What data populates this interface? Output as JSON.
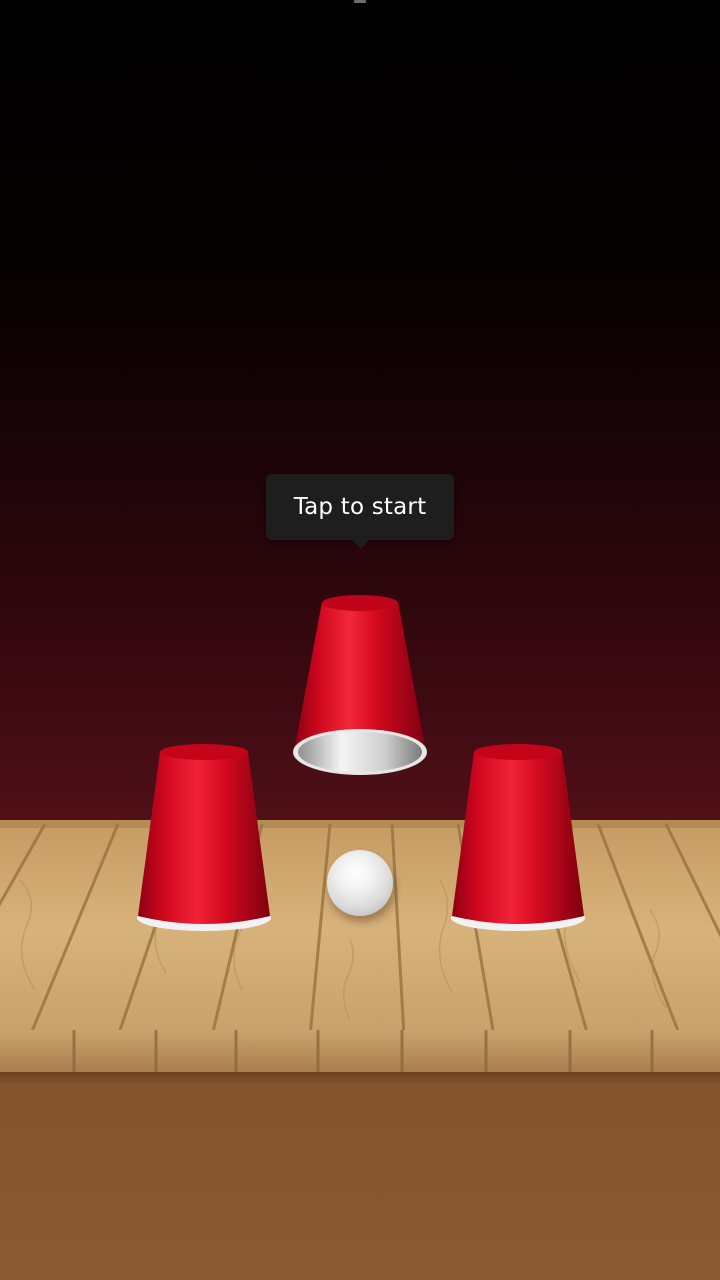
{
  "game": {
    "prompt": "Tap to start",
    "cups": [
      {
        "id": "left",
        "state": "down",
        "color": "#d0021b"
      },
      {
        "id": "center",
        "state": "lifted",
        "color": "#d0021b"
      },
      {
        "id": "right",
        "state": "down",
        "color": "#d0021b"
      }
    ],
    "ball": {
      "visible": true,
      "under": "center"
    }
  },
  "colors": {
    "cup_red": "#d0021b",
    "table_wood": "#d2ab73",
    "table_front": "#8a5a34",
    "background_top": "#000000",
    "background_bottom": "#521118"
  }
}
